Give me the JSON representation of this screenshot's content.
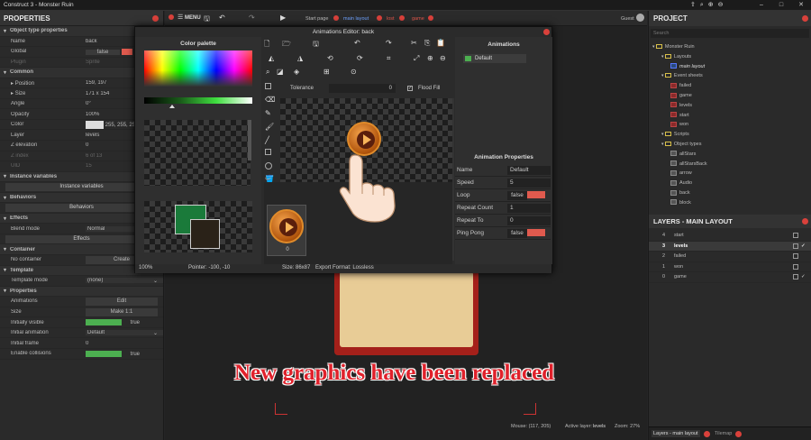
{
  "titlebar": {
    "title": "Construct 3 - Monster Ruin"
  },
  "window_controls": [
    "–",
    "□",
    "✕"
  ],
  "top_tabs": {
    "menu_label": "MENU",
    "tabs": [
      "Start page",
      "main layout",
      "lost",
      "game"
    ],
    "user": "Guest"
  },
  "properties": {
    "title": "PROPERTIES",
    "rows": [
      {
        "type": "section",
        "label": "Object type properties"
      },
      {
        "label": "Name",
        "value": "back"
      },
      {
        "label": "Global",
        "value": "false",
        "toggle": "red"
      },
      {
        "label": "Plugin",
        "value": "Sprite",
        "dim": true
      },
      {
        "type": "section",
        "label": "Common"
      },
      {
        "label": "Position",
        "value": "159, 197",
        "expander": true
      },
      {
        "label": "Size",
        "value": "171 x 154",
        "expander": true
      },
      {
        "label": "Angle",
        "value": "0°"
      },
      {
        "label": "Opacity",
        "value": "100%"
      },
      {
        "label": "Color",
        "value": "255, 255, 255",
        "swatch": true
      },
      {
        "label": "Layer",
        "value": "levels"
      },
      {
        "label": "Z elevation",
        "value": "0"
      },
      {
        "label": "Z index",
        "value": "6 of 13",
        "dim": true
      },
      {
        "label": "UID",
        "value": "15",
        "dim": true
      },
      {
        "type": "section",
        "label": "Instance variables"
      },
      {
        "type": "button",
        "label": "Instance variables"
      },
      {
        "type": "section",
        "label": "Behaviors"
      },
      {
        "type": "button",
        "label": "Behaviors"
      },
      {
        "type": "section",
        "label": "Effects"
      },
      {
        "label": "Blend mode",
        "value": "Normal",
        "dropdown": true
      },
      {
        "type": "button",
        "label": "Effects"
      },
      {
        "type": "section",
        "label": "Container"
      },
      {
        "label": "No container",
        "value": "Create",
        "valbtn": true
      },
      {
        "type": "section",
        "label": "Template"
      },
      {
        "label": "Template mode",
        "value": "(none)",
        "dropdown": true
      },
      {
        "type": "section",
        "label": "Properties"
      },
      {
        "label": "Animations",
        "value": "Edit",
        "valbtn": true
      },
      {
        "label": "Size",
        "value": "Make 1:1",
        "valbtn": true
      },
      {
        "label": "Initially visible",
        "value": "true",
        "toggle": "green"
      },
      {
        "label": "Initial animation",
        "value": "Default",
        "dropdown": true
      },
      {
        "label": "Initial frame",
        "value": "0"
      },
      {
        "label": "Enable collisions",
        "value": "true",
        "toggle": "green"
      }
    ]
  },
  "project": {
    "title": "PROJECT",
    "search_placeholder": "Search",
    "tree": [
      {
        "depth": 0,
        "kind": "folder",
        "label": "Monster Ruin"
      },
      {
        "depth": 1,
        "kind": "folder",
        "label": "Layouts"
      },
      {
        "depth": 2,
        "kind": "layout",
        "label": "main layout"
      },
      {
        "depth": 1,
        "kind": "folder",
        "label": "Event sheets"
      },
      {
        "depth": 2,
        "kind": "sheet",
        "label": "failed"
      },
      {
        "depth": 2,
        "kind": "sheet",
        "label": "game"
      },
      {
        "depth": 2,
        "kind": "sheet",
        "label": "levels"
      },
      {
        "depth": 2,
        "kind": "sheet",
        "label": "start"
      },
      {
        "depth": 2,
        "kind": "sheet",
        "label": "won"
      },
      {
        "depth": 1,
        "kind": "folder",
        "label": "Scripts"
      },
      {
        "depth": 1,
        "kind": "folder",
        "label": "Object types"
      },
      {
        "depth": 2,
        "kind": "obj",
        "label": "allStars"
      },
      {
        "depth": 2,
        "kind": "obj",
        "label": "allStarsBack"
      },
      {
        "depth": 2,
        "kind": "obj",
        "label": "arrow"
      },
      {
        "depth": 2,
        "kind": "obj",
        "label": "Audio"
      },
      {
        "depth": 2,
        "kind": "obj",
        "label": "back"
      },
      {
        "depth": 2,
        "kind": "obj",
        "label": "block"
      }
    ]
  },
  "layers": {
    "title": "LAYERS - MAIN LAYOUT",
    "rows": [
      {
        "num": "4",
        "name": "start",
        "selected": false,
        "visible": false
      },
      {
        "num": "3",
        "name": "levels",
        "selected": true,
        "visible": true
      },
      {
        "num": "2",
        "name": "failed",
        "selected": false,
        "visible": false
      },
      {
        "num": "1",
        "name": "won",
        "selected": false,
        "visible": false
      },
      {
        "num": "0",
        "name": "game",
        "selected": false,
        "visible": true
      }
    ],
    "bottom_tabs": [
      "Layers - main layout",
      "Tilemap"
    ]
  },
  "status": {
    "mouse": "Mouse: (117, 205)",
    "active_layer_label": "Active layer:",
    "active_layer": "levels",
    "zoom": "Zoom: 27%"
  },
  "anim_editor": {
    "title": "Animations Editor: back",
    "palette_label": "Color palette",
    "tolerance_label": "Tolerance",
    "tolerance_value": "0",
    "flood_fill_label": "Flood Fill",
    "zoom": "100%",
    "pointer": "Pointer: -100, -10",
    "size": "Size: 86x87",
    "export": "Export Format: Lossless",
    "frame_index": "0",
    "animations_label": "Animations",
    "animations": [
      "Default"
    ],
    "anim_props_title": "Animation Properties",
    "anim_props": [
      {
        "name": "Name",
        "value": "Default"
      },
      {
        "name": "Speed",
        "value": "5"
      },
      {
        "name": "Loop",
        "value": "false",
        "toggle": true
      },
      {
        "name": "Repeat Count",
        "value": "1"
      },
      {
        "name": "Repeat To",
        "value": "0"
      },
      {
        "name": "Ping Pong",
        "value": "false",
        "toggle": true
      }
    ],
    "primary_color": "#1a7a3a",
    "secondary_color": "#2a2218"
  },
  "caption": "New graphics have been replaced",
  "colors": {
    "accent_red": "#d9413b",
    "tab_red": "#e0574b"
  }
}
